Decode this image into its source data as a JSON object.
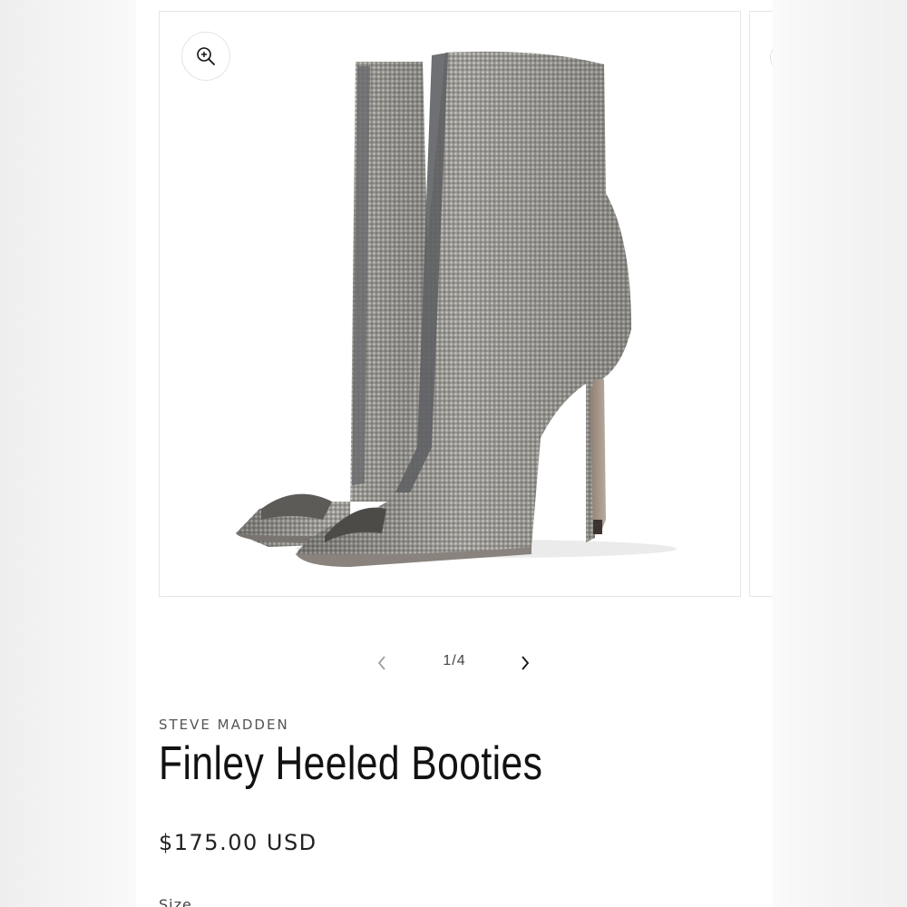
{
  "product": {
    "vendor": "STEVE MADDEN",
    "title": "Finley Heeled Booties",
    "price": "$175.00 USD",
    "option_label": "Size"
  },
  "gallery": {
    "counter": "1/4",
    "image_alt": "Silver rhinestone peep-toe stiletto ankle booties",
    "icons": {
      "zoom": "zoom-in-icon",
      "prev": "chevron-left-icon",
      "next": "chevron-right-icon"
    }
  },
  "colors": {
    "text": "#121212",
    "border": "#e6e6e6",
    "boot_silver": "#9a9893"
  }
}
